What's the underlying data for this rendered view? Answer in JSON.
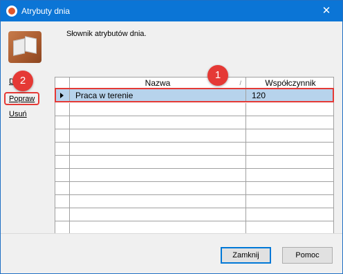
{
  "window": {
    "title": "Atrybuty dnia",
    "close_glyph": "✕"
  },
  "header": {
    "description": "Słownik atrybutów dnia."
  },
  "sidebar": {
    "links": [
      {
        "label": "Dodaj"
      },
      {
        "label": "Popraw"
      },
      {
        "label": "Usuń"
      }
    ]
  },
  "table": {
    "columns": [
      {
        "label": "Nazwa"
      },
      {
        "label": "Współczynnik"
      }
    ],
    "sort_glyph": "/",
    "rows": [
      {
        "nazwa": "Praca w terenie",
        "wspolczynnik": "120",
        "selected": true
      }
    ],
    "empty_rows": 11
  },
  "annotations": {
    "badge_1": "1",
    "badge_2": "2",
    "highlight_color": "#e53935"
  },
  "footer": {
    "close_label": "Zamknij",
    "help_label": "Pomoc"
  },
  "icons": {
    "app": "app-logo-icon",
    "dictionary": "book-icon"
  }
}
